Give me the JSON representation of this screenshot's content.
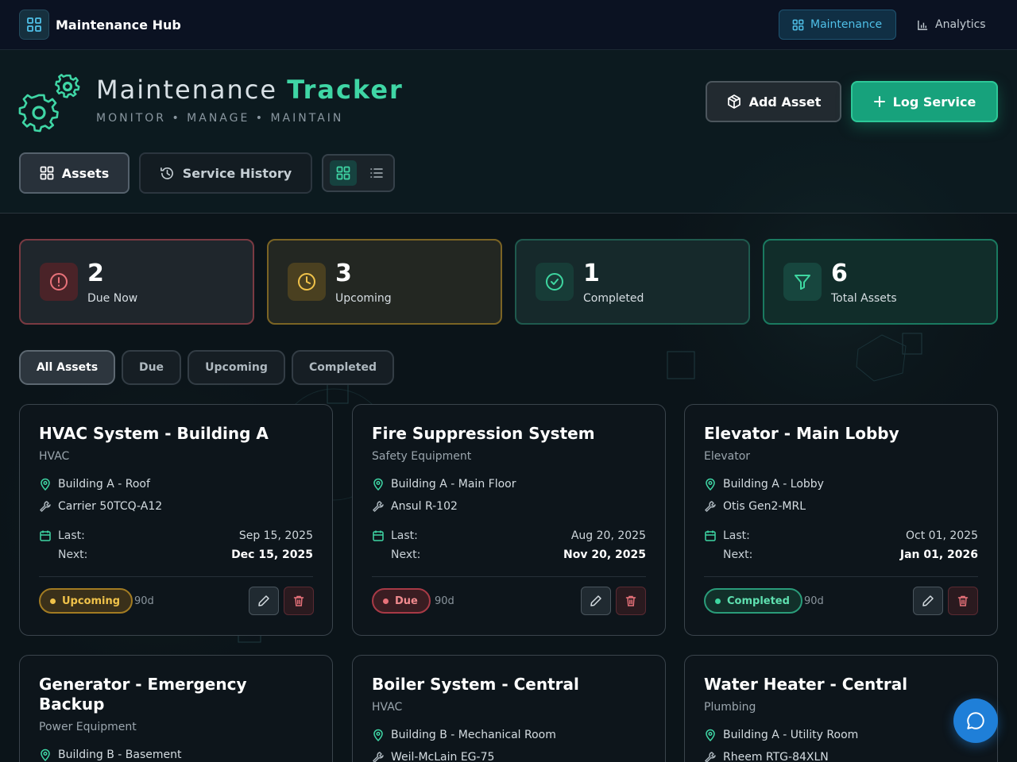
{
  "nav": {
    "brand": "Maintenance Hub",
    "links": [
      {
        "label": "Maintenance",
        "active": true
      },
      {
        "label": "Analytics",
        "active": false
      }
    ]
  },
  "header": {
    "title_main": "Maintenance",
    "title_accent": "Tracker",
    "subtitle": "MONITOR • MANAGE • MAINTAIN",
    "add_asset_label": "Add Asset",
    "log_service_label": "Log Service"
  },
  "tabs": {
    "assets_label": "Assets",
    "history_label": "Service History"
  },
  "stats": [
    {
      "value": "2",
      "label": "Due Now",
      "color": "#e8727a"
    },
    {
      "value": "3",
      "label": "Upcoming",
      "color": "#f0c24a"
    },
    {
      "value": "1",
      "label": "Completed",
      "color": "#3ed6a0"
    },
    {
      "value": "6",
      "label": "Total Assets",
      "color": "#3ed6a0"
    }
  ],
  "filters": [
    "All Assets",
    "Due",
    "Upcoming",
    "Completed"
  ],
  "assets": [
    {
      "name": "HVAC System - Building A",
      "category": "HVAC",
      "location": "Building A - Roof",
      "model": "Carrier 50TCQ-A12",
      "last_label": "Last:",
      "last": "Sep 15, 2025",
      "next_label": "Next:",
      "next": "Dec 15, 2025",
      "status": "Upcoming",
      "interval": "90d"
    },
    {
      "name": "Fire Suppression System",
      "category": "Safety Equipment",
      "location": "Building A - Main Floor",
      "model": "Ansul R-102",
      "last_label": "Last:",
      "last": "Aug 20, 2025",
      "next_label": "Next:",
      "next": "Nov 20, 2025",
      "status": "Due",
      "interval": "90d"
    },
    {
      "name": "Elevator - Main Lobby",
      "category": "Elevator",
      "location": "Building A - Lobby",
      "model": "Otis Gen2-MRL",
      "last_label": "Last:",
      "last": "Oct 01, 2025",
      "next_label": "Next:",
      "next": "Jan 01, 2026",
      "status": "Completed",
      "interval": "90d"
    },
    {
      "name": "Generator - Emergency Backup",
      "category": "Power Equipment",
      "location": "Building B - Basement",
      "model": ""
    },
    {
      "name": "Boiler System - Central",
      "category": "HVAC",
      "location": "Building B - Mechanical Room",
      "model": "Weil-McLain EG-75"
    },
    {
      "name": "Water Heater - Central",
      "category": "Plumbing",
      "location": "Building A - Utility Room",
      "model": "Rheem RTG-84XLN"
    }
  ],
  "colors": {
    "accent": "#3fd6a5",
    "primary_button": "#17a27c",
    "fab": "#1f7fd8"
  }
}
